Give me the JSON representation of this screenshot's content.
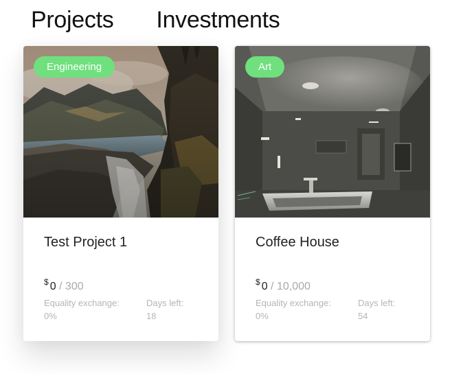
{
  "tabs": [
    {
      "label": "Projects"
    },
    {
      "label": "Investments"
    }
  ],
  "projects": [
    {
      "category": "Engineering",
      "title": "Test Project 1",
      "currency": "$",
      "raised": "0",
      "separator": "/",
      "goal": "300",
      "equity_label": "Equality exchange:",
      "equity_value": "0%",
      "days_label": "Days left:",
      "days_value": "18"
    },
    {
      "category": "Art",
      "title": "Coffee House",
      "currency": "$",
      "raised": "0",
      "separator": "/",
      "goal": "10,000",
      "equity_label": "Equality exchange:",
      "equity_value": "0%",
      "days_label": "Days left:",
      "days_value": "54"
    }
  ],
  "colors": {
    "badge": "#6fe07d",
    "muted_text": "#b5b5b5",
    "title_text": "#222222"
  }
}
